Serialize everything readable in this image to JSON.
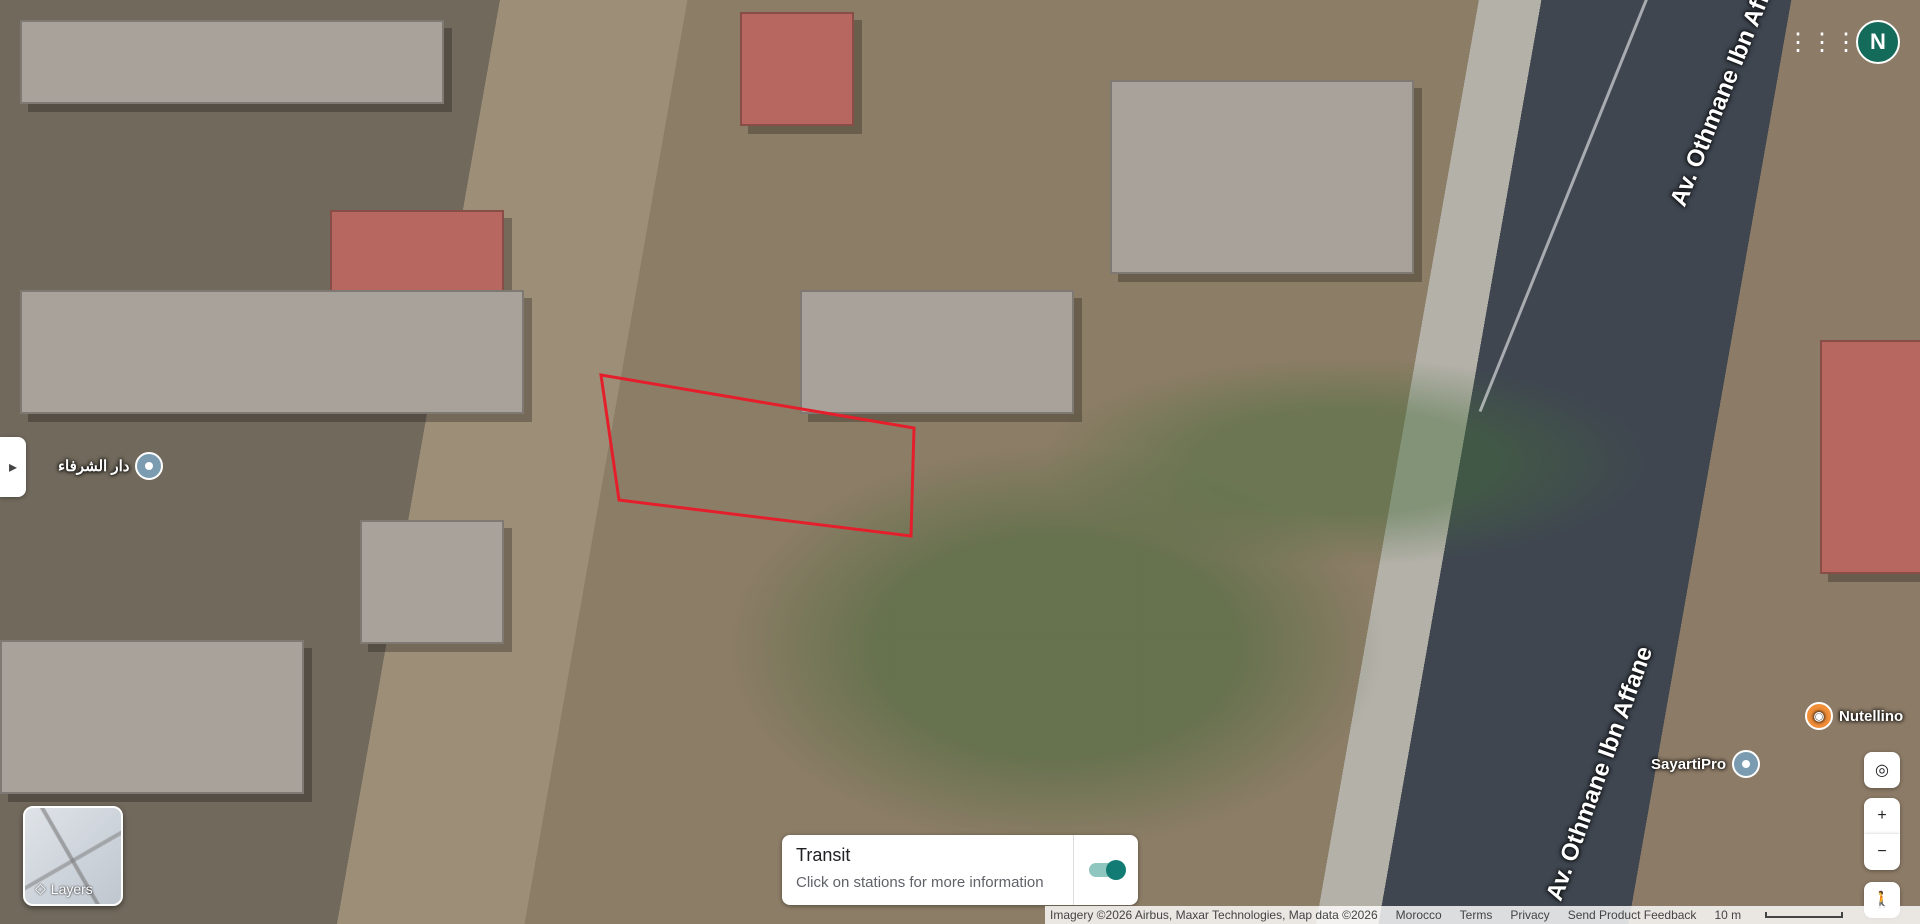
{
  "map": {
    "street_labels": [
      "Av. Othmane Ibn Affane",
      "Av. Othmane Ibn Affane"
    ],
    "pois": [
      {
        "name": "دار الشرفاء"
      },
      {
        "name": "Nutellino"
      },
      {
        "name": "SayartiPro"
      }
    ]
  },
  "top_right": {
    "apps_icon": "apps-grid-icon",
    "avatar_letter": "N"
  },
  "left_toggle": {
    "icon": "chevron-right-icon"
  },
  "layers": {
    "label": "Layers"
  },
  "transit": {
    "title": "Transit",
    "subtitle": "Click on stations for more information"
  },
  "controls": {
    "locate_icon": "my-location-icon",
    "zoom_in_label": "+",
    "zoom_out_label": "−",
    "pegman_icon": "street-view-person-icon"
  },
  "footer": {
    "imagery": "Imagery ©2026 Airbus, Maxar Technologies, Map data ©2026",
    "region": "Morocco",
    "terms": "Terms",
    "privacy": "Privacy",
    "feedback": "Send Product Feedback",
    "scale": "10 m"
  }
}
